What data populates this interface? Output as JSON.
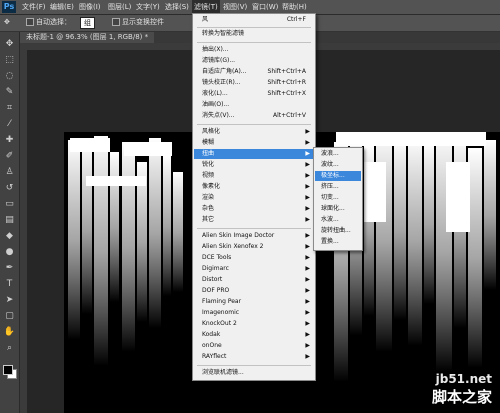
{
  "menubar": {
    "logo": "Ps",
    "items": [
      "文件(F)",
      "编辑(E)",
      "图像(I)",
      "图层(L)",
      "文字(Y)",
      "选择(S)",
      "滤镜(T)",
      "视图(V)",
      "窗口(W)",
      "帮助(H)"
    ]
  },
  "options": {
    "auto_select": "自动选择：",
    "auto_select_value": "组",
    "show_transform": "显示变换控件"
  },
  "document": {
    "tab_title": "未标题-1 @ 96.3% (图层 1, RGB/8) *"
  },
  "filter_menu": {
    "items": [
      {
        "label": "风",
        "shortcut": "Ctrl+F"
      },
      {
        "label": "转换为智能滤镜"
      },
      {
        "label": "抽出(X)..."
      },
      {
        "label": "滤镜库(G)..."
      },
      {
        "label": "自适应广角(A)...",
        "shortcut": "Shift+Ctrl+A"
      },
      {
        "label": "镜头校正(R)...",
        "shortcut": "Shift+Ctrl+R"
      },
      {
        "label": "液化(L)...",
        "shortcut": "Shift+Ctrl+X"
      },
      {
        "label": "油画(O)..."
      },
      {
        "label": "消失点(V)...",
        "shortcut": "Alt+Ctrl+V"
      },
      {
        "label": "风格化"
      },
      {
        "label": "模糊"
      },
      {
        "label": "扭曲"
      },
      {
        "label": "锐化"
      },
      {
        "label": "视频"
      },
      {
        "label": "像素化"
      },
      {
        "label": "渲染"
      },
      {
        "label": "杂色"
      },
      {
        "label": "其它"
      },
      {
        "label": "Alien Skin Image Doctor"
      },
      {
        "label": "Alien Skin Xenofex 2"
      },
      {
        "label": "DCE Tools"
      },
      {
        "label": "Digimarc"
      },
      {
        "label": "Distort"
      },
      {
        "label": "DOF PRO"
      },
      {
        "label": "Flaming Pear"
      },
      {
        "label": "Imagenomic"
      },
      {
        "label": "KnockOut 2"
      },
      {
        "label": "Kodak"
      },
      {
        "label": "onOne"
      },
      {
        "label": "RAYflect"
      },
      {
        "label": "浏览联机滤镜..."
      }
    ]
  },
  "distort_submenu": {
    "items": [
      "波浪...",
      "波纹...",
      "极坐标...",
      "挤压...",
      "切变...",
      "球面化...",
      "水波...",
      "旋转扭曲...",
      "置换..."
    ]
  },
  "watermark": {
    "url": "jb51.net",
    "name": "脚本之家"
  }
}
